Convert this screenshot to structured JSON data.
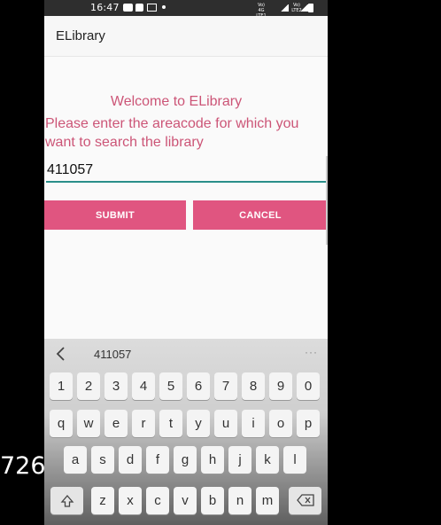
{
  "side_text": "726",
  "statusbar": {
    "time": "16:47",
    "net1": "Vo) 4G\nLTE1 ↓↑",
    "net2": "",
    "net3": "Vo) LTE2"
  },
  "app": {
    "title": "ELibrary"
  },
  "main": {
    "welcome": "Welcome to ELibrary",
    "prompt": "Please enter the areacode for which you want to search the library",
    "areacode_value": "411057",
    "submit_label": "SUBMIT",
    "cancel_label": "CANCEL"
  },
  "keyboard": {
    "suggestion": "411057",
    "more": "···",
    "numbers": [
      "1",
      "2",
      "3",
      "4",
      "5",
      "6",
      "7",
      "8",
      "9",
      "0"
    ],
    "row_q": [
      "q",
      "w",
      "e",
      "r",
      "t",
      "y",
      "u",
      "i",
      "o",
      "p"
    ],
    "row_a": [
      "a",
      "s",
      "d",
      "f",
      "g",
      "h",
      "j",
      "k",
      "l"
    ],
    "row_z": [
      "z",
      "x",
      "c",
      "v",
      "b",
      "n",
      "m"
    ]
  }
}
